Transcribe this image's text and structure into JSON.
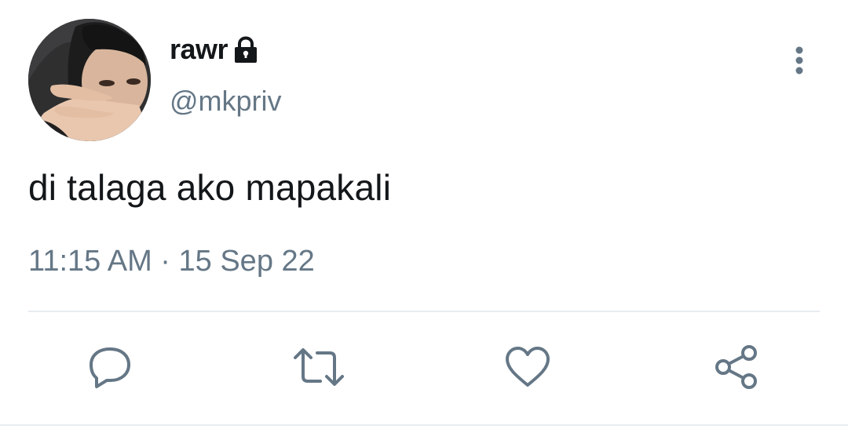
{
  "author": {
    "display_name": "rawr",
    "handle": "@mkpriv",
    "avatar_icon": "profile-photo",
    "protected_icon": "lock-icon"
  },
  "tweet": {
    "text": "di talaga ako mapakali",
    "time": "11:15 AM",
    "separator": "·",
    "date": "15 Sep 22"
  },
  "actions": [
    {
      "name": "reply",
      "icon": "reply-icon"
    },
    {
      "name": "retweet",
      "icon": "retweet-icon"
    },
    {
      "name": "like",
      "icon": "heart-icon"
    },
    {
      "name": "share",
      "icon": "share-icon"
    }
  ],
  "colors": {
    "text_primary": "#14171a",
    "text_secondary": "#657786",
    "divider": "#e6ecf0",
    "icon": "#657786"
  }
}
